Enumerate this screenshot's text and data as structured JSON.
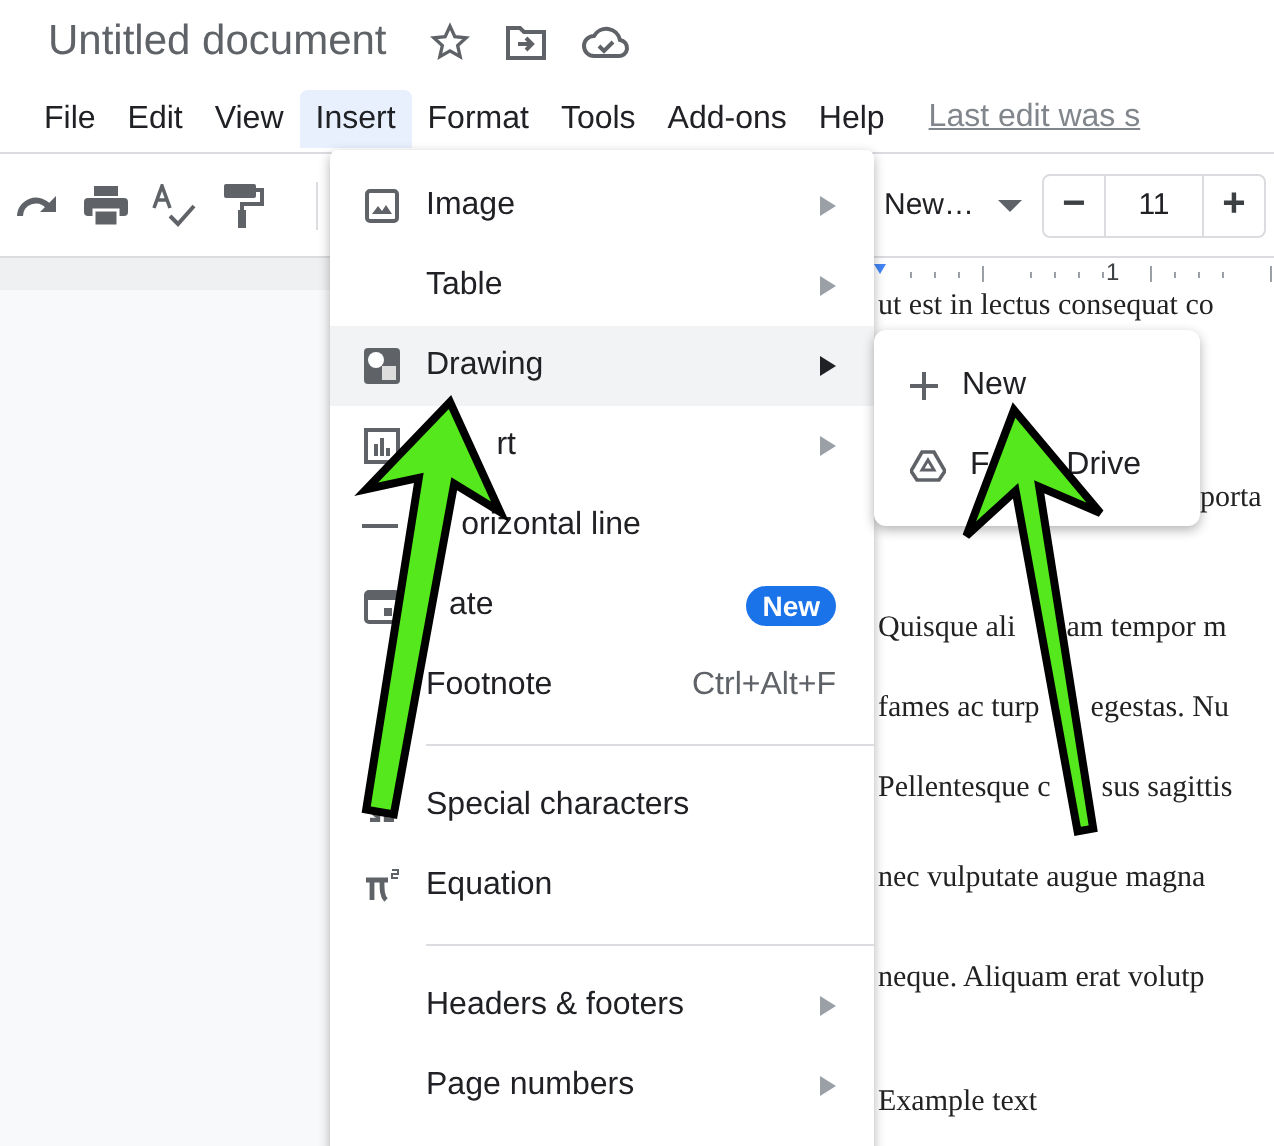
{
  "document_title": "Untitled document",
  "menu_bar": {
    "items": [
      {
        "label": "File",
        "selected": false
      },
      {
        "label": "Edit",
        "selected": false
      },
      {
        "label": "View",
        "selected": false
      },
      {
        "label": "Insert",
        "selected": true
      },
      {
        "label": "Format",
        "selected": false
      },
      {
        "label": "Tools",
        "selected": false
      },
      {
        "label": "Add-ons",
        "selected": false
      },
      {
        "label": "Help",
        "selected": false
      }
    ],
    "last_edit": "Last edit was s"
  },
  "toolbar": {
    "font": "New…",
    "decrease": "−",
    "font_size": "11",
    "increase": "+"
  },
  "ruler": {
    "label": "1"
  },
  "insert_menu": {
    "sections": [
      [
        {
          "label": "Image",
          "selected": false,
          "submenu": true
        },
        {
          "label": "Table",
          "selected": false,
          "submenu": true
        },
        {
          "label": "Drawing",
          "selected": true,
          "submenu": true
        },
        {
          "label": "rt",
          "selected": false,
          "submenu": true
        },
        {
          "label": "orizontal line",
          "selected": false,
          "submenu": false
        },
        {
          "label": "ate",
          "selected": false,
          "submenu": false,
          "badge": "New"
        },
        {
          "label": "Footnote",
          "selected": false,
          "submenu": false,
          "shortcut": "Ctrl+Alt+F"
        }
      ],
      [
        {
          "label": "Special characters",
          "selected": false,
          "submenu": false
        },
        {
          "label": "Equation",
          "selected": false,
          "submenu": false
        }
      ],
      [
        {
          "label": "Headers & footers",
          "selected": false,
          "submenu": true
        },
        {
          "label": "Page numbers",
          "selected": false,
          "submenu": true
        }
      ]
    ]
  },
  "drawing_submenu": {
    "items": [
      {
        "parts": [
          "New"
        ]
      },
      {
        "parts": [
          "F",
          "Drive"
        ]
      }
    ]
  },
  "document": {
    "lines": [
      {
        "parts": [
          "ut est in lectus consequat co"
        ],
        "kind": "full"
      },
      {
        "parts": [
          "porta"
        ],
        "kind": "partial"
      },
      {
        "parts": [
          "Quisque ali",
          "am tempor m"
        ],
        "kind": "full"
      },
      {
        "parts": [
          "fames ac turp",
          "egestas. Nu"
        ],
        "kind": "full"
      },
      {
        "parts": [
          "Pellentesque c",
          "sus sagittis"
        ],
        "kind": "full"
      },
      {
        "parts": [
          "nec vulputate augue magna"
        ],
        "kind": "full"
      },
      {
        "parts": [
          "neque. Aliquam erat volutp"
        ],
        "kind": "full"
      },
      {
        "parts": [
          "Example text"
        ],
        "kind": "full"
      }
    ]
  }
}
